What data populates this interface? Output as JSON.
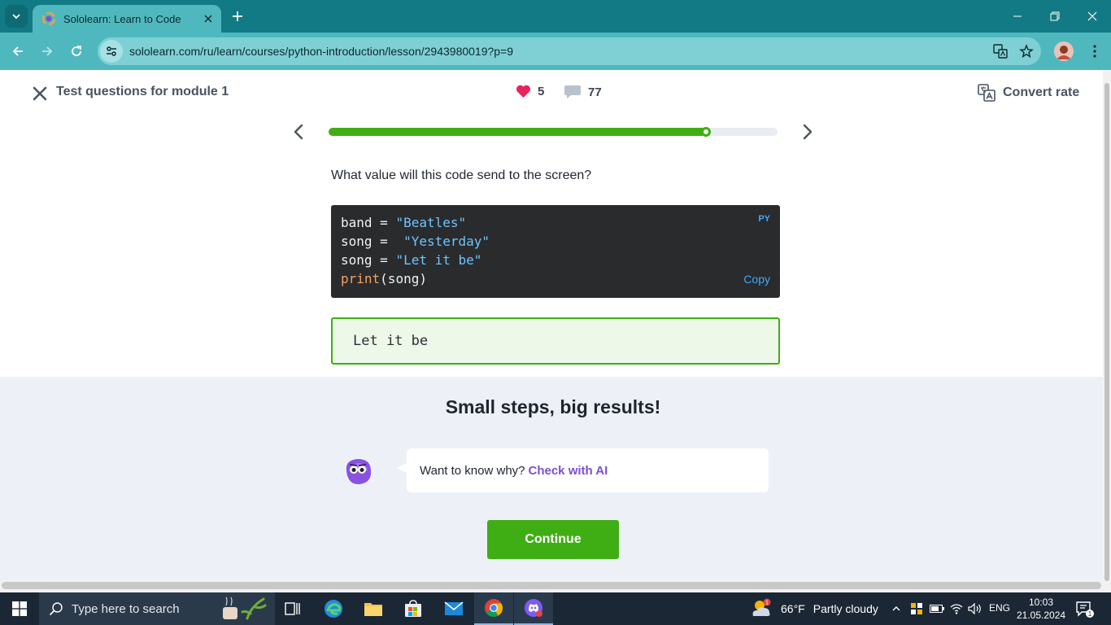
{
  "browser": {
    "tab_title": "Sololearn: Learn to Code",
    "url": "sololearn.com/ru/learn/courses/python-introduction/lesson/2943980019?p=9"
  },
  "lesson": {
    "title": "Test questions for module 1",
    "hearts": "5",
    "comments": "77",
    "convert_label": "Convert rate",
    "progress": 0.84
  },
  "question": {
    "text": "What value will this code send to the screen?",
    "language_badge": "PY",
    "copy_label": "Copy",
    "code": {
      "l1_var": "band = ",
      "l1_str": "\"Beatles\"",
      "l2_var": "song =  ",
      "l2_str": "\"Yesterday\"",
      "l3_var": "song = ",
      "l3_str": "\"Let it be\"",
      "l4_fn": "print",
      "l4_rest": "(song)"
    },
    "answer": "Let it be"
  },
  "feedback": {
    "heading": "Small steps, big results!",
    "prompt": "Want to know why?",
    "ai_link": "Check with AI",
    "continue_label": "Continue"
  },
  "taskbar": {
    "search_placeholder": "Type here to search",
    "temperature": "66°F",
    "condition": "Partly cloudy",
    "weather_badge": "1",
    "language": "ENG",
    "time": "10:03",
    "date": "21.05.2024",
    "notification_count": "1"
  },
  "colors": {
    "accent_green": "#3fae14",
    "chrome_teal": "#127a85",
    "ai_purple": "#7b4fd6"
  }
}
